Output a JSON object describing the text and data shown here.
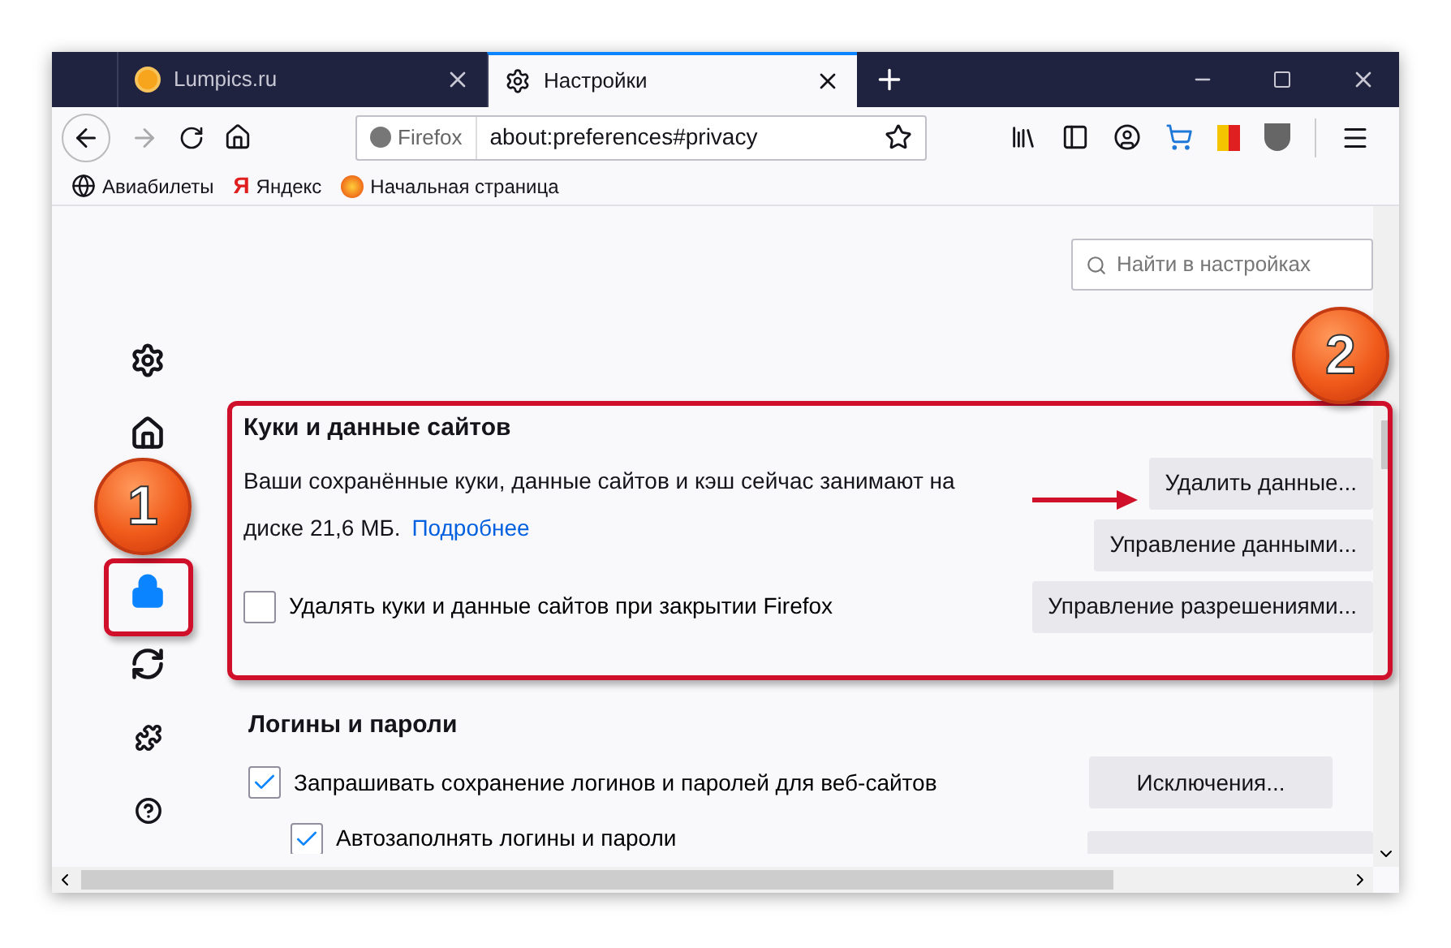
{
  "tabs": [
    {
      "label": "Lumpics.ru",
      "selected": false
    },
    {
      "label": "Настройки",
      "selected": true
    }
  ],
  "toolbar": {
    "identity": "Firefox",
    "url": "about:preferences#privacy"
  },
  "bookmarks": [
    {
      "kind": "globe",
      "label": "Авиабилеты"
    },
    {
      "kind": "yandex",
      "label": "Яндекс",
      "icon_text": "Я"
    },
    {
      "kind": "firefox",
      "label": "Начальная страница"
    }
  ],
  "search": {
    "placeholder": "Найти в настройках"
  },
  "sidebar": {
    "items": [
      {
        "kind": "gear",
        "selected": false
      },
      {
        "kind": "home",
        "selected": false
      },
      {
        "kind": "lock",
        "selected": true
      },
      {
        "kind": "sync",
        "selected": false
      },
      {
        "kind": "puzzle",
        "selected": false
      },
      {
        "kind": "help",
        "selected": false
      }
    ]
  },
  "cookies": {
    "title": "Куки и данные сайтов",
    "text": "Ваши сохранённые куки, данные сайтов и кэш сейчас занимают на диске 21,6 МБ.",
    "link": "Подробнее",
    "checkbox": {
      "label": "Удалять куки и данные сайтов при закрытии Firefox",
      "checked": false
    },
    "buttons": [
      "Удалить данные...",
      "Управление данными...",
      "Управление разрешениями..."
    ]
  },
  "logins": {
    "title": "Логины и пароли",
    "options": [
      {
        "label": "Запрашивать сохранение логинов и паролей для веб-сайтов",
        "checked": true,
        "button": "Исключения..."
      },
      {
        "label": "Автозаполнять логины и пароли",
        "checked": true
      }
    ]
  },
  "annotations": [
    "1",
    "2"
  ]
}
